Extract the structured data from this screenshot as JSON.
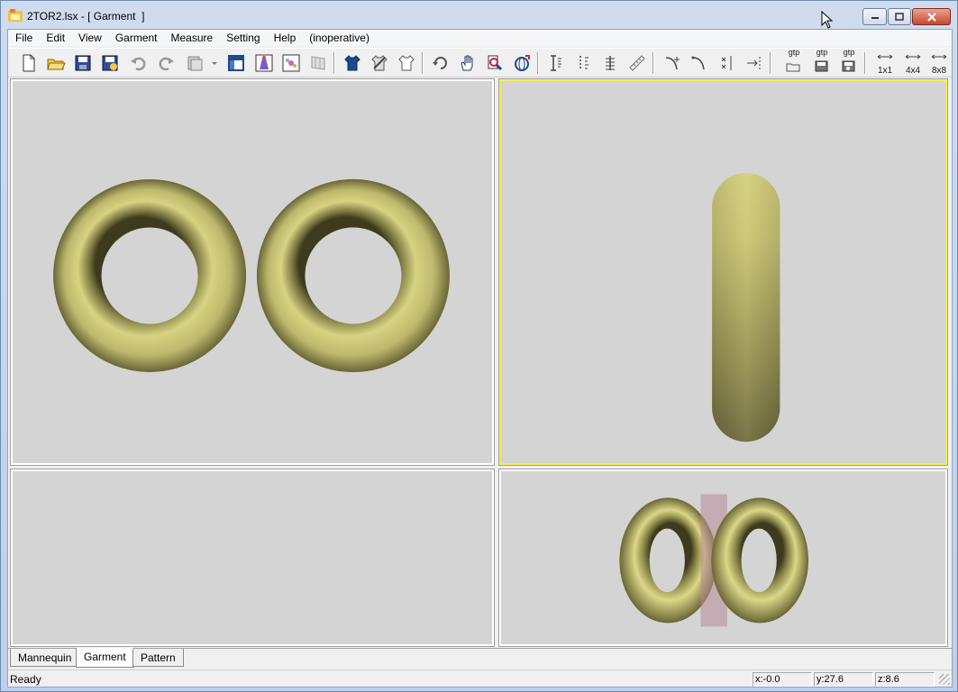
{
  "window": {
    "title": "2TOR2.lsx - [ Garment  ]"
  },
  "menu": [
    {
      "id": "file",
      "label": "File"
    },
    {
      "id": "edit",
      "label": "Edit"
    },
    {
      "id": "view",
      "label": "View"
    },
    {
      "id": "garment",
      "label": "Garment"
    },
    {
      "id": "measure",
      "label": "Measure"
    },
    {
      "id": "setting",
      "label": "Setting"
    },
    {
      "id": "help",
      "label": "Help"
    },
    {
      "id": "inoperative",
      "label": "(inoperative)"
    }
  ],
  "toolbar": {
    "gtp_open_label": "gtp",
    "gtp_save_label": "gtp",
    "gtp_saveas_label": "gtp",
    "grid_1x1_label": "1x1",
    "grid_4x4_label": "4x4",
    "grid_8x8_label": "8x8"
  },
  "tabs": [
    {
      "label": "Mannequin",
      "selected": false
    },
    {
      "label": "Garment",
      "selected": true
    },
    {
      "label": "Pattern",
      "selected": false
    }
  ],
  "status": {
    "text": "Ready",
    "x": "x:-0.0",
    "y": "y:27.6",
    "z": "z:8.6"
  },
  "colors": {
    "torus": "#c9c47a",
    "viewport_bg": "#d4d4d4",
    "active_border": "#f2ee52",
    "clip_plane": "#b78a95"
  }
}
